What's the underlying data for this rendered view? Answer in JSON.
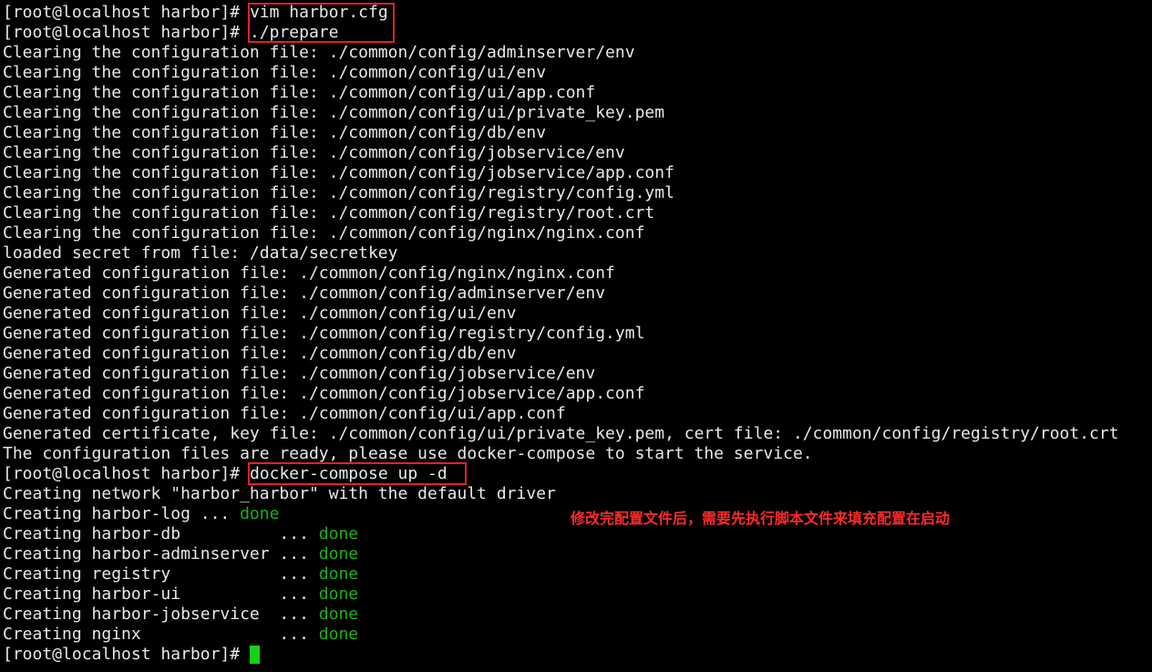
{
  "prompt": "[root@localhost harbor]# ",
  "commands": {
    "vim": "vim harbor.cfg",
    "prepare": "./prepare",
    "compose": "docker-compose up -d"
  },
  "output_lines": [
    "Clearing the configuration file: ./common/config/adminserver/env",
    "Clearing the configuration file: ./common/config/ui/env",
    "Clearing the configuration file: ./common/config/ui/app.conf",
    "Clearing the configuration file: ./common/config/ui/private_key.pem",
    "Clearing the configuration file: ./common/config/db/env",
    "Clearing the configuration file: ./common/config/jobservice/env",
    "Clearing the configuration file: ./common/config/jobservice/app.conf",
    "Clearing the configuration file: ./common/config/registry/config.yml",
    "Clearing the configuration file: ./common/config/registry/root.crt",
    "Clearing the configuration file: ./common/config/nginx/nginx.conf",
    "loaded secret from file: /data/secretkey",
    "Generated configuration file: ./common/config/nginx/nginx.conf",
    "Generated configuration file: ./common/config/adminserver/env",
    "Generated configuration file: ./common/config/ui/env",
    "Generated configuration file: ./common/config/registry/config.yml",
    "Generated configuration file: ./common/config/db/env",
    "Generated configuration file: ./common/config/jobservice/env",
    "Generated configuration file: ./common/config/jobservice/app.conf",
    "Generated configuration file: ./common/config/ui/app.conf",
    "Generated certificate, key file: ./common/config/ui/private_key.pem, cert file: ./common/config/registry/root.crt",
    "The configuration files are ready, please use docker-compose to start the service."
  ],
  "network_line": "Creating network \"harbor_harbor\" with the default driver",
  "creating": [
    {
      "prefix": "Creating harbor-log ... ",
      "status": "done"
    },
    {
      "prefix": "Creating harbor-db          ... ",
      "status": "done"
    },
    {
      "prefix": "Creating harbor-adminserver ... ",
      "status": "done"
    },
    {
      "prefix": "Creating registry           ... ",
      "status": "done"
    },
    {
      "prefix": "Creating harbor-ui          ... ",
      "status": "done"
    },
    {
      "prefix": "Creating harbor-jobservice  ... ",
      "status": "done"
    },
    {
      "prefix": "Creating nginx              ... ",
      "status": "done"
    }
  ],
  "annotation": "修改完配置文件后，需要先执行脚本文件来填充配置在启动",
  "colors": {
    "background": "#000000",
    "text": "#e8e8e8",
    "done": "#1fae1f",
    "highlight_box": "#e0202a",
    "annotation": "#ff2a2a",
    "cursor": "#18d018"
  }
}
